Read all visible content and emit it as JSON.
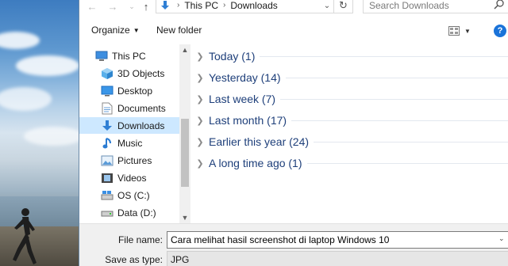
{
  "address": {
    "crumbs": [
      "This PC",
      "Downloads"
    ],
    "search_placeholder": "Search Downloads"
  },
  "toolbar": {
    "organize_label": "Organize",
    "new_folder_label": "New folder"
  },
  "nav": {
    "items": [
      {
        "label": "This PC",
        "icon": "computer-icon"
      },
      {
        "label": "3D Objects",
        "icon": "cube-icon"
      },
      {
        "label": "Desktop",
        "icon": "desktop-icon"
      },
      {
        "label": "Documents",
        "icon": "document-icon"
      },
      {
        "label": "Downloads",
        "icon": "download-arrow-icon",
        "selected": true
      },
      {
        "label": "Music",
        "icon": "music-note-icon"
      },
      {
        "label": "Pictures",
        "icon": "picture-icon"
      },
      {
        "label": "Videos",
        "icon": "film-icon"
      },
      {
        "label": "OS (C:)",
        "icon": "drive-icon"
      },
      {
        "label": "Data (D:)",
        "icon": "drive-icon"
      }
    ]
  },
  "groups": [
    {
      "label": "Today (1)"
    },
    {
      "label": "Yesterday (14)"
    },
    {
      "label": "Last week (7)"
    },
    {
      "label": "Last month (17)"
    },
    {
      "label": "Earlier this year (24)"
    },
    {
      "label": "A long time ago (1)"
    }
  ],
  "save": {
    "file_name_label": "File name:",
    "file_name_value": "Cara melihat hasil screenshot di laptop Windows 10",
    "save_type_label": "Save as type:",
    "save_type_value": "JPG"
  },
  "colors": {
    "accent": "#1a73d9",
    "selected_bg": "#cde8ff",
    "group_text": "#1e3f7a"
  }
}
